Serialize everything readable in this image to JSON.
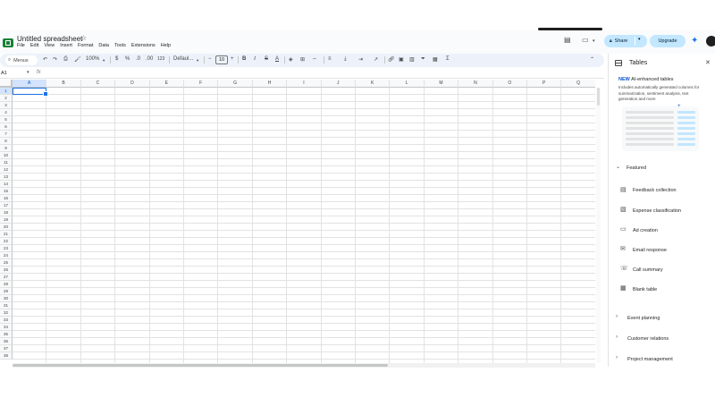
{
  "header": {
    "doc_title": "Untitled spreadsheet",
    "menu": [
      "File",
      "Edit",
      "View",
      "Insert",
      "Format",
      "Data",
      "Tools",
      "Extensions",
      "Help"
    ],
    "share_label": "Share",
    "upgrade_label": "Upgrade"
  },
  "toolbar": {
    "menus_label": "Menus",
    "zoom": "100%",
    "currency": "$",
    "percent": "%",
    "dec_less": ".0",
    "dec_more": ".00",
    "number_format": "123",
    "font": "Defaul...",
    "font_size": "10",
    "minus": "−",
    "plus": "+",
    "bold": "B",
    "italic": "I",
    "strike": "S",
    "text_color": "A",
    "functions": "Σ"
  },
  "formula_bar": {
    "cell_ref": "A1",
    "fx": "fx"
  },
  "grid": {
    "columns": [
      "A",
      "B",
      "C",
      "D",
      "E",
      "F",
      "G",
      "H",
      "I",
      "J",
      "K",
      "L",
      "M",
      "N",
      "O",
      "P",
      "Q"
    ],
    "rows": [
      "1",
      "2",
      "3",
      "4",
      "5",
      "6",
      "7",
      "8",
      "9",
      "10",
      "11",
      "12",
      "13",
      "14",
      "15",
      "16",
      "17",
      "18",
      "19",
      "20",
      "21",
      "22",
      "23",
      "24",
      "25",
      "26",
      "27",
      "28",
      "29",
      "30",
      "31",
      "32",
      "33",
      "34",
      "35",
      "36",
      "37",
      "38"
    ]
  },
  "panel": {
    "title": "Tables",
    "new_tag": "NEW",
    "new_title": "AI-enhanced tables",
    "description": "Includes automatically generated columns for summarization, sentiment analysis, text generation and more",
    "featured_label": "Featured",
    "featured_items": [
      {
        "label": "Feedback collection",
        "icon": "feedback-icon"
      },
      {
        "label": "Expense classification",
        "icon": "expense-icon"
      },
      {
        "label": "Ad creation",
        "icon": "ad-icon"
      },
      {
        "label": "Email response",
        "icon": "email-icon"
      },
      {
        "label": "Call summary",
        "icon": "call-icon"
      },
      {
        "label": "Blank table",
        "icon": "table-icon"
      }
    ],
    "sections": [
      "Event planning",
      "Customer relations",
      "Project management"
    ]
  },
  "colors": {
    "accent": "#1a73e8",
    "sheets_green": "#188038",
    "button_bg": "#c2e7ff",
    "toolbar_bg": "#edf2fa"
  }
}
